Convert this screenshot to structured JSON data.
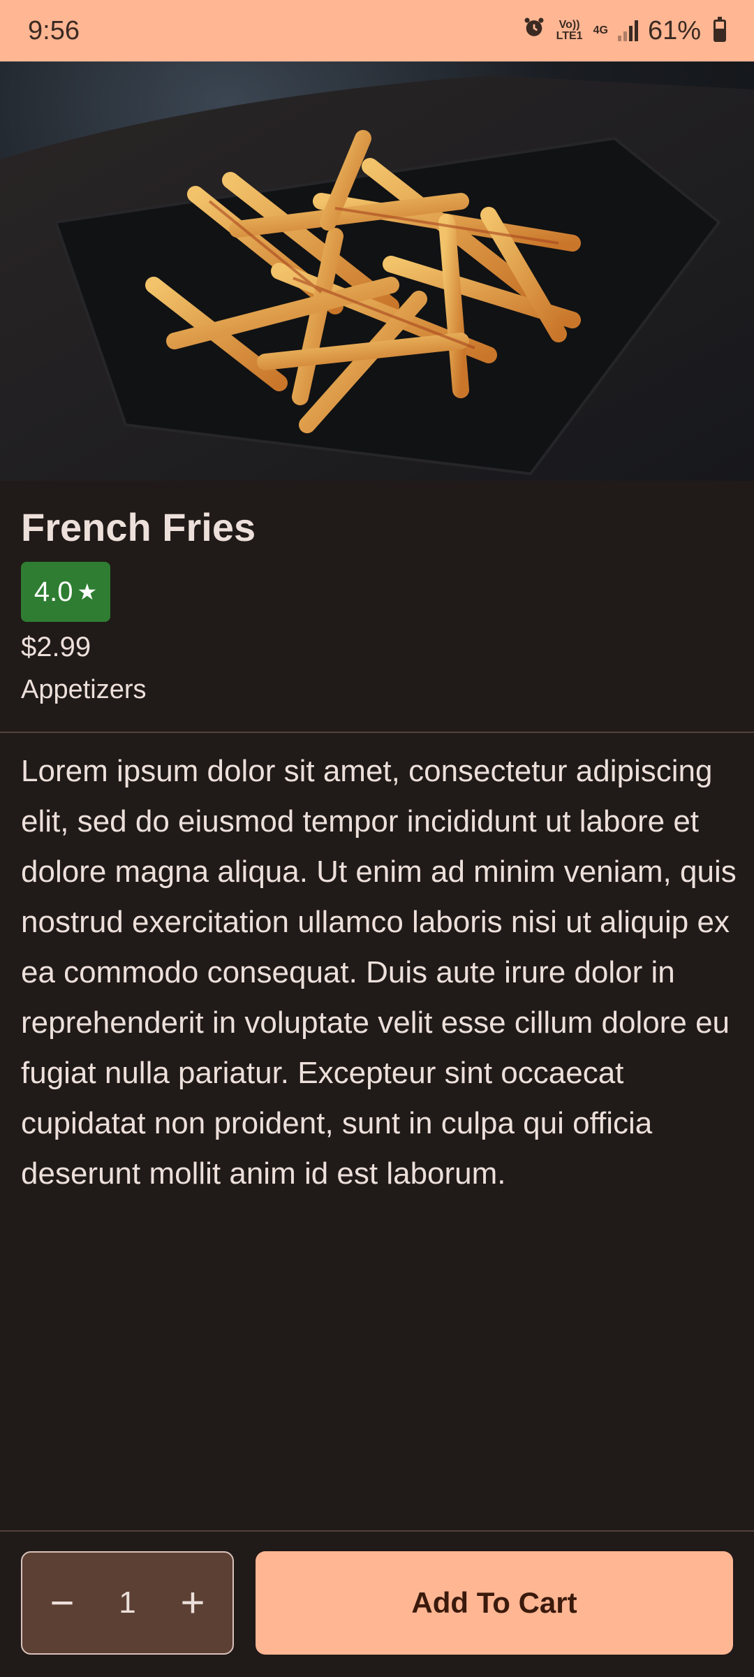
{
  "status_bar": {
    "time": "9:56",
    "network_volte": "Vo)) LTE1",
    "network_gen": "4G",
    "battery_text": "61%",
    "battery_level": 0.61
  },
  "product": {
    "image_icon": "french-fries-photo",
    "name": "French Fries",
    "rating": "4.0",
    "rating_icon": "★",
    "price": "$2.99",
    "category": "Appetizers",
    "description": "Lorem ipsum dolor sit amet, consectetur adipiscing elit, sed do eiusmod tempor incididunt ut labore et dolore magna aliqua. Ut enim ad minim veniam, quis nostrud exercitation ullamco laboris nisi ut aliquip ex ea commodo consequat. Duis aute irure dolor in reprehenderit in voluptate velit esse cillum dolore eu fugiat nulla pariatur. Excepteur sint occaecat cupidatat non proident, sunt in culpa qui officia deserunt mollit anim id est laborum."
  },
  "cart": {
    "decrement_label": "−",
    "increment_label": "+",
    "quantity": "1",
    "add_label": "Add To Cart"
  },
  "colors": {
    "accent": "#ffb693",
    "background": "#201a18",
    "rating_badge": "#2e7d32",
    "stepper_bg": "#5c4034"
  }
}
